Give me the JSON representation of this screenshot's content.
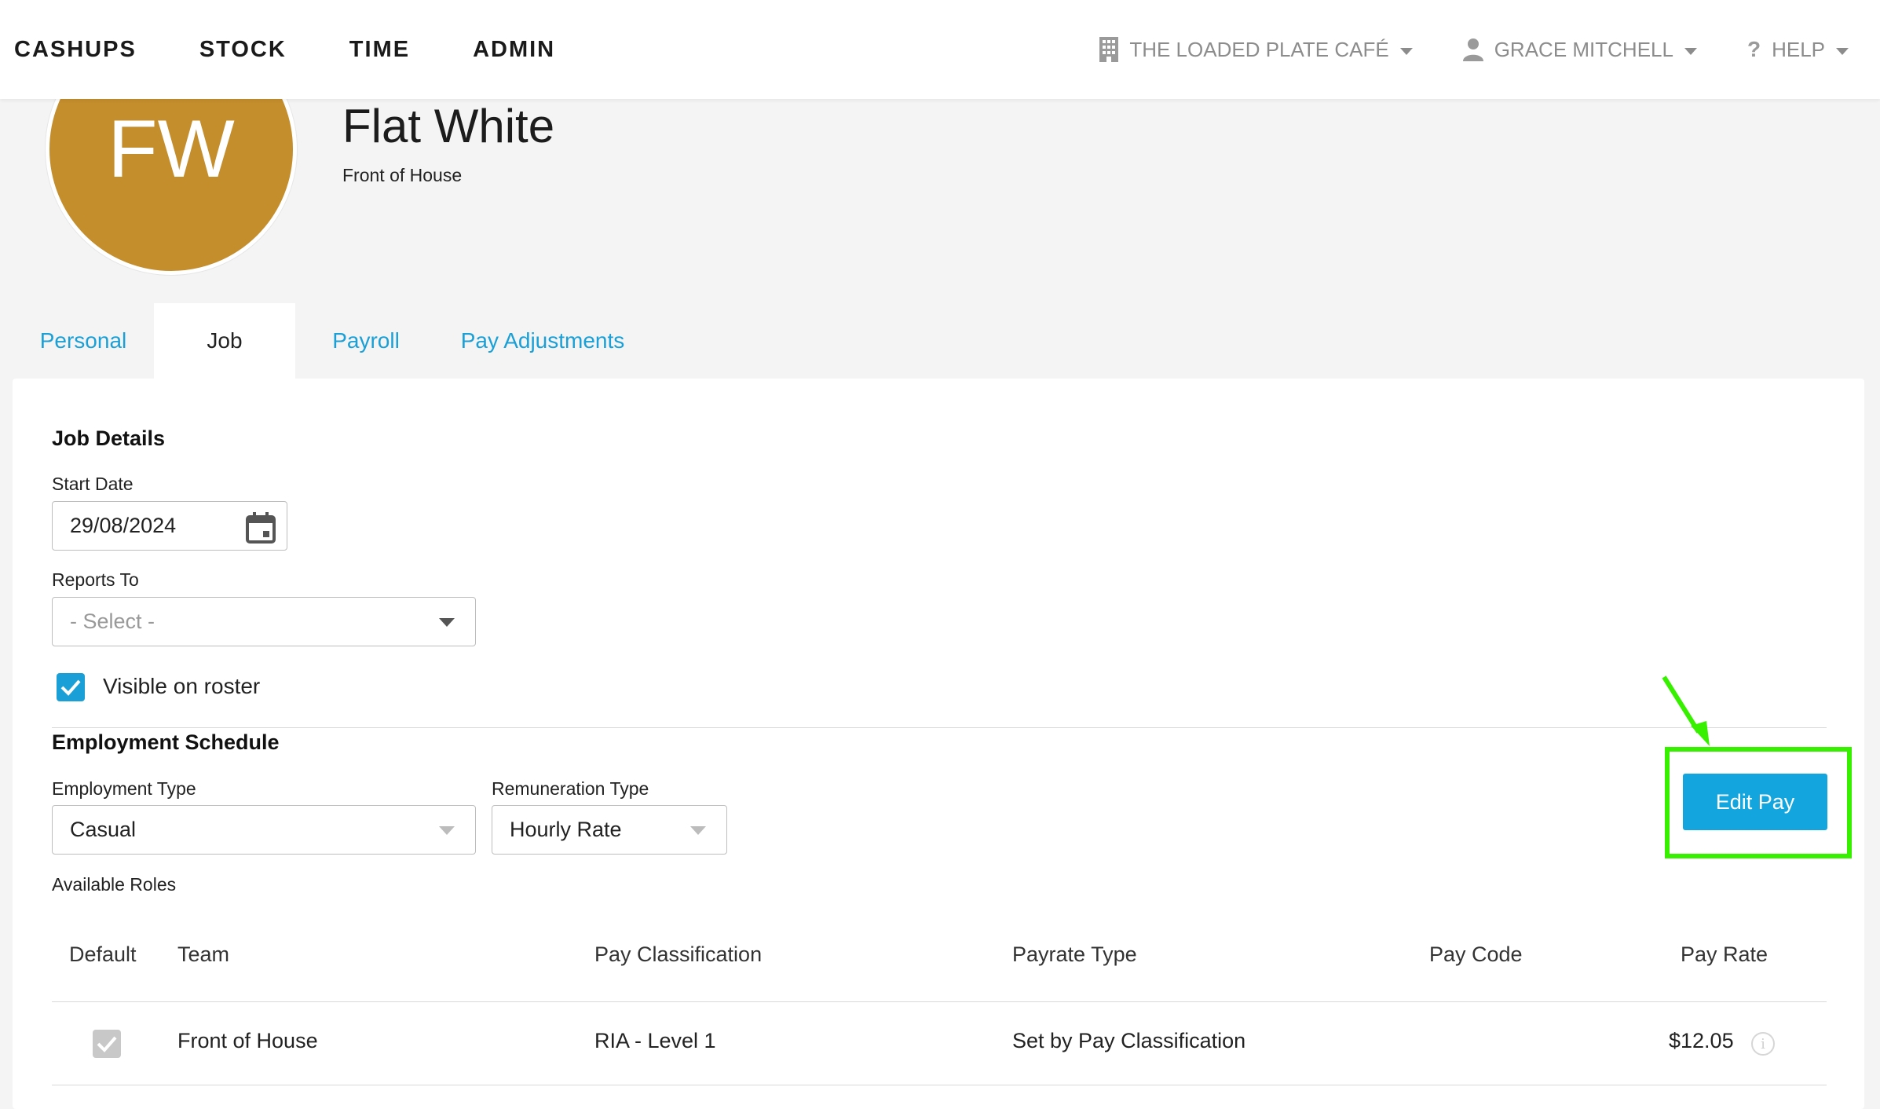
{
  "nav": {
    "items": [
      "CASHUPS",
      "STOCK",
      "TIME",
      "ADMIN"
    ],
    "venue": "THE LOADED PLATE CAFÉ",
    "user": "GRACE MITCHELL",
    "help": "HELP"
  },
  "employee": {
    "initials": "FW",
    "name": "Flat White",
    "department": "Front of House",
    "avatar_color": "#c48e2d"
  },
  "tabs": [
    {
      "label": "Personal",
      "active": false
    },
    {
      "label": "Job",
      "active": true
    },
    {
      "label": "Payroll",
      "active": false
    },
    {
      "label": "Pay Adjustments",
      "active": false
    }
  ],
  "job_details": {
    "title": "Job Details",
    "start_date_label": "Start Date",
    "start_date_value": "29/08/2024",
    "reports_to_label": "Reports To",
    "reports_to_placeholder": "- Select -",
    "visible_on_roster_label": "Visible on roster",
    "visible_on_roster_checked": true
  },
  "employment_schedule": {
    "title": "Employment Schedule",
    "employment_type_label": "Employment Type",
    "employment_type_value": "Casual",
    "remuneration_type_label": "Remuneration Type",
    "remuneration_type_value": "Hourly Rate",
    "edit_pay_label": "Edit Pay",
    "available_roles_label": "Available Roles"
  },
  "roles_table": {
    "headers": [
      "Default",
      "Team",
      "Pay Classification",
      "Payrate Type",
      "Pay Code",
      "Pay Rate"
    ],
    "rows": [
      {
        "default": true,
        "team": "Front of House",
        "pay_classification": "RIA - Level 1",
        "payrate_type": "Set by Pay Classification",
        "pay_code": "",
        "pay_rate": "$12.05"
      }
    ]
  },
  "colors": {
    "accent": "#1aa0d6",
    "highlight": "#36f000"
  },
  "icons": {
    "venue": "building-icon",
    "user": "user-icon",
    "help": "question-icon",
    "date": "calendar-icon",
    "info": "info-icon"
  }
}
